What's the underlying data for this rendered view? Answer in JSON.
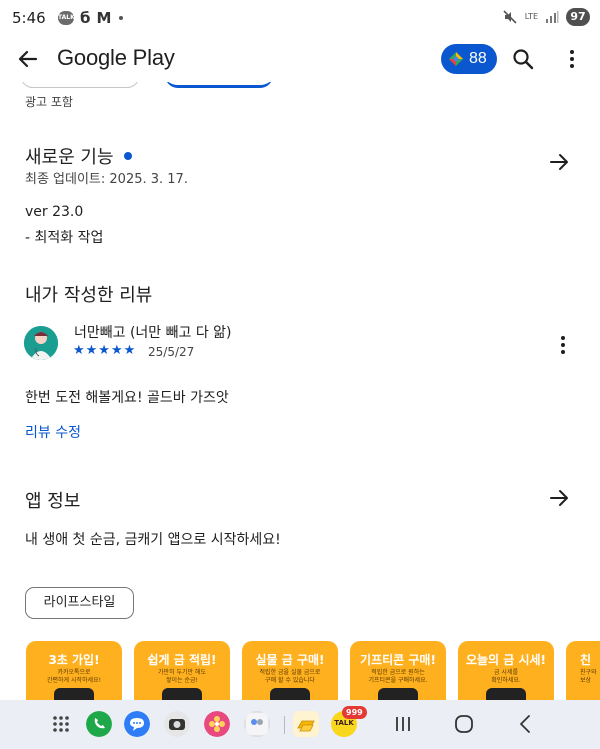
{
  "status_bar": {
    "time": "5:46",
    "talk_icon_text": "TALK",
    "left_glyphs": [
      "б",
      "M"
    ],
    "lte": "LTE",
    "battery": "97"
  },
  "app_bar": {
    "title": "Google Play",
    "points": "88"
  },
  "ads_label": "광고 포함",
  "whats_new": {
    "title": "새로운 기능",
    "updated": "최종 업데이트: 2025. 3. 17.",
    "version": "ver 23.0",
    "note": "- 최적화 작업"
  },
  "my_review": {
    "title": "내가 작성한 리뷰",
    "reviewer": "너만빼고 (너만 빼고 다 앎)",
    "stars": "★★★★★",
    "rating": 5,
    "date": "25/5/27",
    "text": "한번 도전 해볼게요! 골드바 가즈앗",
    "edit_label": "리뷰 수정"
  },
  "app_info": {
    "title": "앱 정보",
    "description": "내 생애 첫 순금, 금캐기 앱으로 시작하세요!",
    "category": "라이프스타일"
  },
  "screenshots": [
    {
      "title": "3초 가입!",
      "sub": "카카오톡으로\n간편하게 시작하세요!"
    },
    {
      "title": "쉽게 금 적립!",
      "sub": "가만히 두기만 해도\n쌓이는 순금!"
    },
    {
      "title": "실물 금 구매!",
      "sub": "적립한 금을 실물 금으로\n구매 할 수 있습니다"
    },
    {
      "title": "기프티콘 구매!",
      "sub": "적립한 금으로 원하는\n기프티콘을 구매하세요."
    },
    {
      "title": "오늘의 금 시세!",
      "sub": "금 시세를\n확인하세요."
    },
    {
      "title": "친",
      "sub": "친구와\n보상"
    }
  ],
  "nav_bar": {
    "badge": "999",
    "talk_label": "TALK"
  },
  "colors": {
    "accent": "#0b57d0",
    "shot_bg": "#ffb01f",
    "avatar": "#1a9e92"
  }
}
